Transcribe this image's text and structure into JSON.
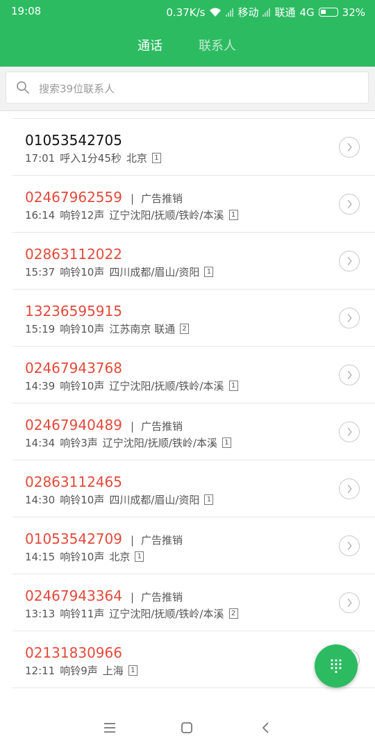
{
  "status_bar": {
    "time": "19:08",
    "speed": "0.37K/s",
    "carrier1": "移动",
    "carrier2": "联通",
    "network": "4G",
    "battery": "32%"
  },
  "tabs": {
    "calls": "通话",
    "contacts": "联系人"
  },
  "search": {
    "placeholder": "搜索39位联系人"
  },
  "calls": [
    {
      "number": "01053542705",
      "tag": "",
      "time": "17:01",
      "status": "呼入1分45秒",
      "location": "北京",
      "sim": "1",
      "missed": false
    },
    {
      "number": "02467962559",
      "tag": "广告推销",
      "time": "16:14",
      "status": "响铃12声",
      "location": "辽宁沈阳/抚顺/铁岭/本溪",
      "sim": "1",
      "missed": true
    },
    {
      "number": "02863112022",
      "tag": "",
      "time": "15:37",
      "status": "响铃10声",
      "location": "四川成都/眉山/资阳",
      "sim": "1",
      "missed": true
    },
    {
      "number": "13236595915",
      "tag": "",
      "time": "15:19",
      "status": "响铃10声",
      "location": "江苏南京 联通",
      "sim": "2",
      "missed": true
    },
    {
      "number": "02467943768",
      "tag": "",
      "time": "14:39",
      "status": "响铃10声",
      "location": "辽宁沈阳/抚顺/铁岭/本溪",
      "sim": "1",
      "missed": true
    },
    {
      "number": "02467940489",
      "tag": "广告推销",
      "time": "14:34",
      "status": "响铃3声",
      "location": "辽宁沈阳/抚顺/铁岭/本溪",
      "sim": "1",
      "missed": true
    },
    {
      "number": "02863112465",
      "tag": "",
      "time": "14:30",
      "status": "响铃10声",
      "location": "四川成都/眉山/资阳",
      "sim": "1",
      "missed": true
    },
    {
      "number": "01053542709",
      "tag": "广告推销",
      "time": "14:15",
      "status": "响铃10声",
      "location": "北京",
      "sim": "1",
      "missed": true
    },
    {
      "number": "02467943364",
      "tag": "广告推销",
      "time": "13:13",
      "status": "响铃11声",
      "location": "辽宁沈阳/抚顺/铁岭/本溪",
      "sim": "2",
      "missed": true
    },
    {
      "number": "02131830966",
      "tag": "",
      "time": "12:11",
      "status": "响铃9声",
      "location": "上海",
      "sim": "1",
      "missed": true
    }
  ],
  "colors": {
    "accent": "#2dbb62",
    "missed": "#e24a3b",
    "normal": "#111111"
  }
}
